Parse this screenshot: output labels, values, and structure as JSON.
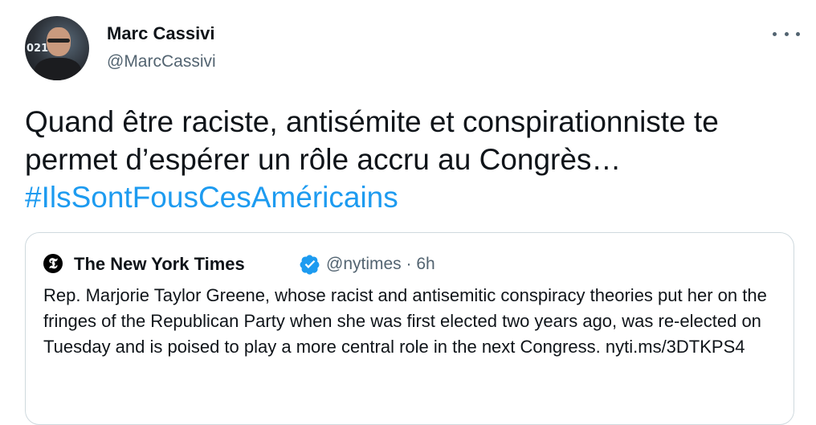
{
  "author": {
    "name": "Marc Cassivi",
    "handle": "@MarcCassivi",
    "avatar_text": "021"
  },
  "more_icon": "more-horizontal-icon",
  "tweet": {
    "text_line1": "Quand être raciste, antisémite et conspirationniste te",
    "text_line2": "permet d’espérer un rôle accru au Congrès…",
    "hashtag": "#IlsSontFousCesAméricains"
  },
  "quoted": {
    "logo_glyph": "𝕿",
    "name": "The New York Times",
    "verified_icon": "verified-badge-icon",
    "handle_time": "@nytimes · 6h",
    "body": "Rep. Marjorie Taylor Greene, whose racist and antisemitic conspiracy theories put her on the fringes of the Republican Party when she was first elected two years ago, was re-elected on Tuesday and is poised to play a more central role in the next Congress. nyti.ms/3DTKPS4"
  },
  "colors": {
    "link": "#1d9bf0",
    "secondary": "#536471",
    "border": "#cfd9de"
  }
}
